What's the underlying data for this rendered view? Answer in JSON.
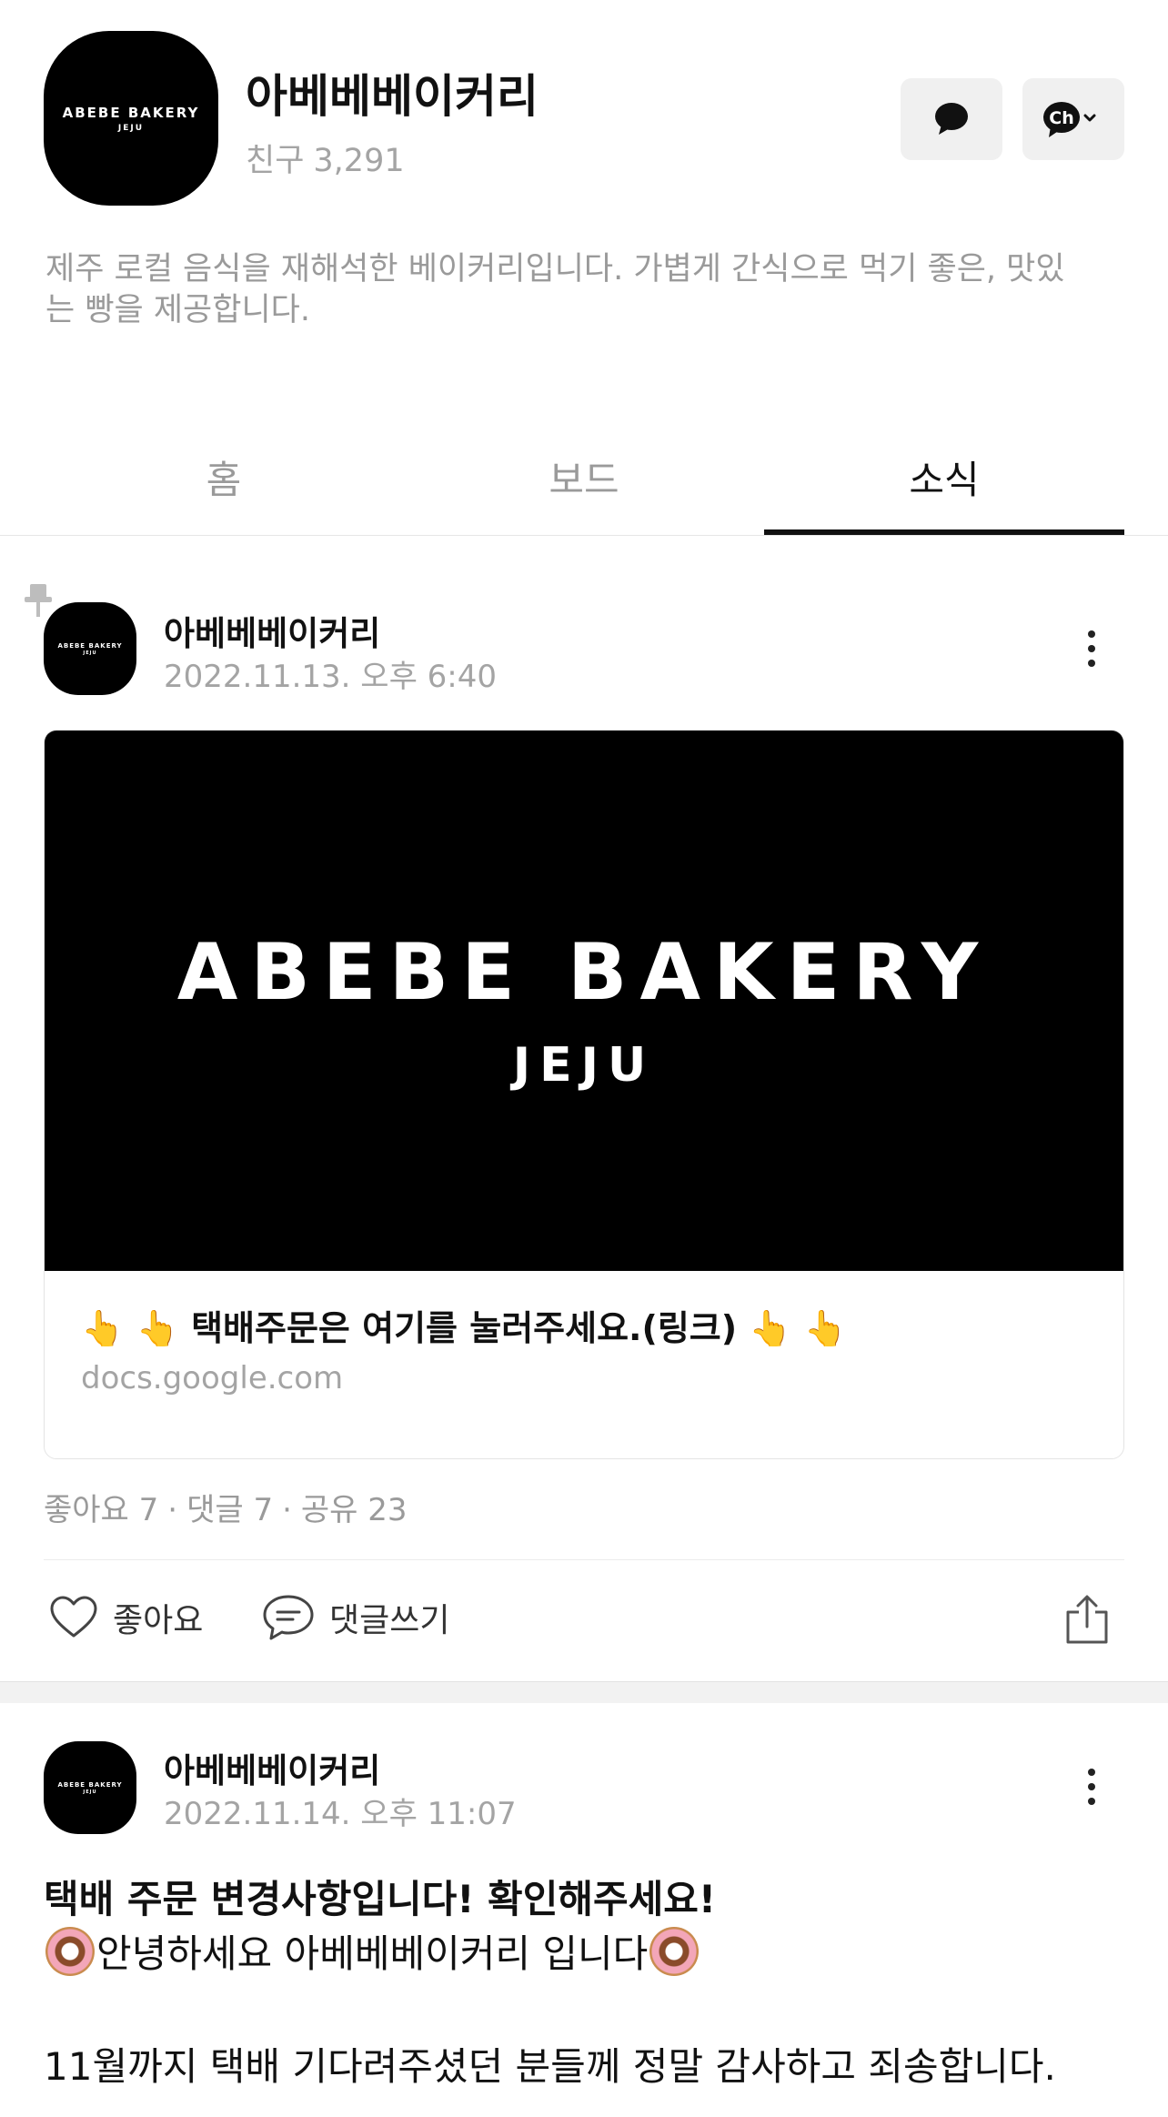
{
  "profile": {
    "logo_line1": "ABEBE BAKERY",
    "logo_line2": "JEJU",
    "name": "아베베베이커리",
    "friends_label": "친구",
    "friends_count": "3,291",
    "description": "제주 로컬 음식을 재해석한 베이커리입니다. 가볍게 간식으로 먹기 좋은, 맛있는 빵을 제공합니다.",
    "channel_button_label": "Ch"
  },
  "tabs": [
    {
      "label": "홈",
      "active": false
    },
    {
      "label": "보드",
      "active": false
    },
    {
      "label": "소식",
      "active": true
    }
  ],
  "posts": [
    {
      "author": "아베베베이커리",
      "date": "2022.11.13. 오후 6:40",
      "pinned": true,
      "card": {
        "image_line1": "ABEBE BAKERY",
        "image_line2": "JEJU",
        "title": "👆 👆 택배주문은 여기를 눌러주세요.(링크) 👆 👆",
        "domain": "docs.google.com"
      },
      "stats": {
        "likes": "좋아요 7",
        "comments": "댓글 7",
        "shares": "공유 23",
        "separator": "·"
      },
      "actions": {
        "like_label": "좋아요",
        "comment_label": "댓글쓰기"
      }
    },
    {
      "author": "아베베베이커리",
      "date": "2022.11.14. 오후 11:07",
      "title": "택배 주문 변경사항입니다! 확인해주세요!",
      "greeting": "안녕하세요 아베베베이커리 입니다",
      "body": "11월까지 택배 기다려주셨던 분들께 정말 감사하고 죄송합니다."
    }
  ],
  "colors": {
    "text_primary": "#111111",
    "text_secondary": "#a4a4a4",
    "button_bg": "#f0f0f0",
    "logo_bg": "#000000"
  }
}
